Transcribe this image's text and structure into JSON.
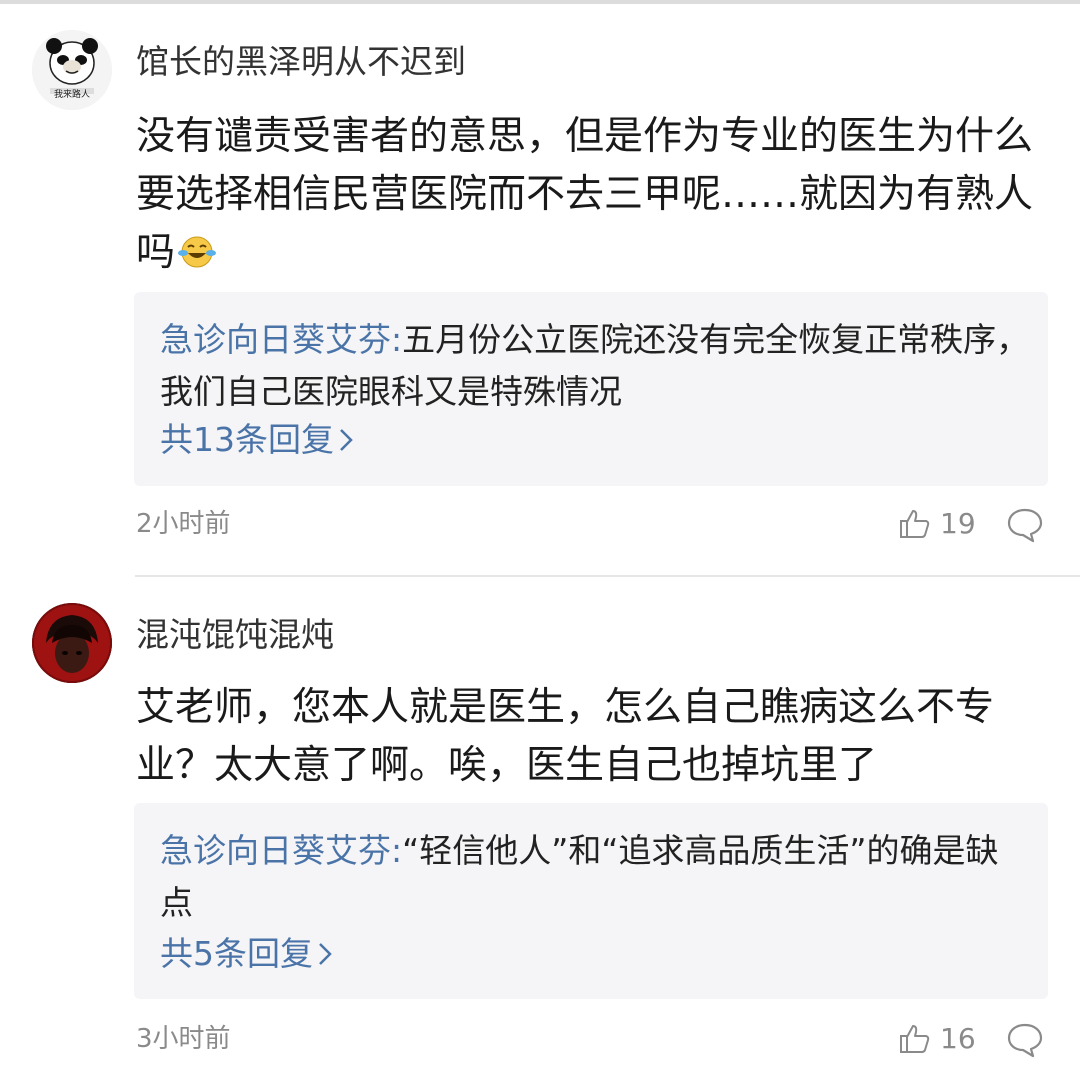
{
  "comments": [
    {
      "username": "馆长的黑泽明从不迟到",
      "avatar_icon": "panda-meme-avatar-icon",
      "avatar_caption": "我来路人",
      "body": "没有谴责受害者的意思，但是作为专业的医生为什么要选择相信民营医院而不去三甲呢……就因为有熟人吗",
      "emoji": "laugh-cry-emoji-icon",
      "reply": {
        "author": "急诊向日葵艾芬",
        "separator": ":",
        "text": "五月份公立医院还没有完全恢复正常秩序，我们自己医院眼科又是特殊情况",
        "count_label": "共13条回复"
      },
      "time": "2小时前",
      "likes": "19",
      "like_icon": "thumbs-up-icon",
      "comment_icon": "comment-bubble-icon"
    },
    {
      "username": "混沌馄饨混炖",
      "avatar_icon": "dark-portrait-avatar-icon",
      "body": "艾老师，您本人就是医生，怎么自己瞧病这么不专业？太大意了啊。唉，医生自己也掉坑里了",
      "reply": {
        "author": "急诊向日葵艾芬",
        "separator": ":",
        "text": "“轻信他人”和“追求高品质生活”的确是缺点",
        "count_label": "共5条回复"
      },
      "time": "3小时前",
      "likes": "16",
      "like_icon": "thumbs-up-icon",
      "comment_icon": "comment-bubble-icon"
    }
  ],
  "colors": {
    "link_blue": "#4a74a8",
    "reply_bg": "#f5f5f7",
    "meta_gray": "#8a8a8a"
  }
}
